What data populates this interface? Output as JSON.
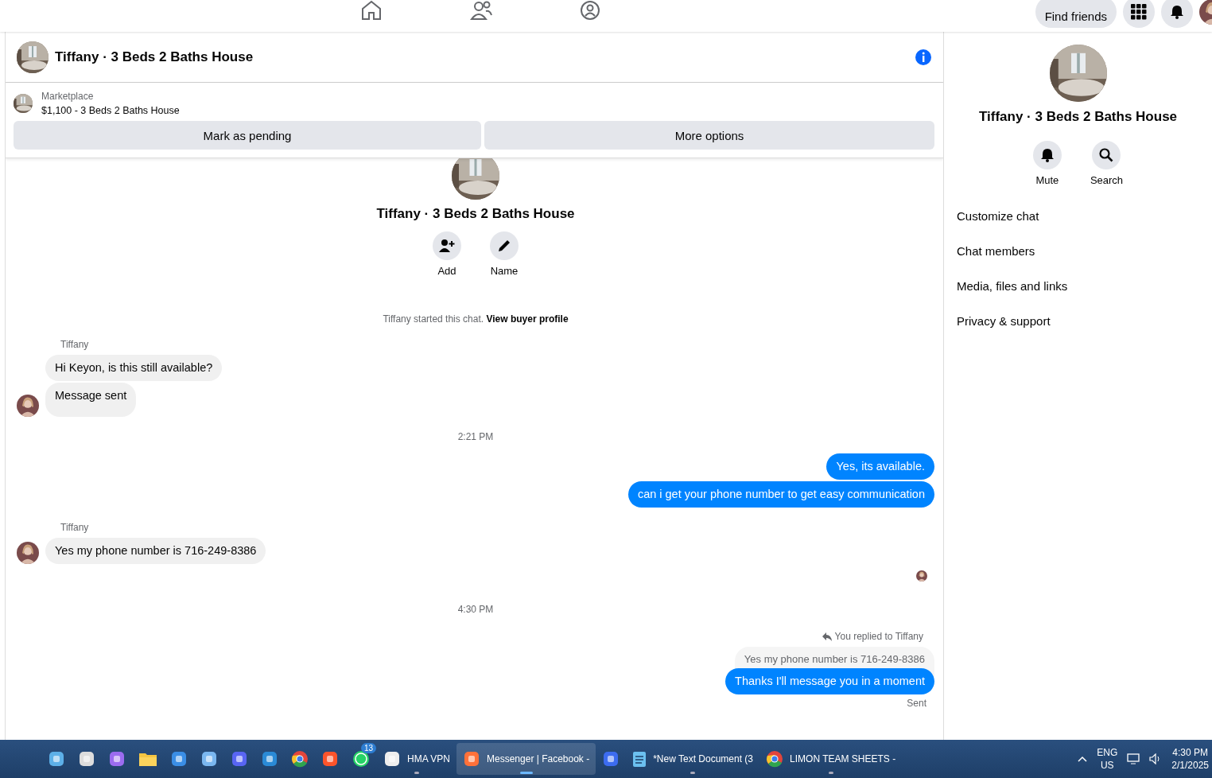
{
  "top_nav": {
    "find_friends": "Find friends"
  },
  "chat_header": {
    "title": "Tiffany · 3 Beds 2 Baths House"
  },
  "marketplace": {
    "label": "Marketplace",
    "listing": "$1,100 - 3 Beds 2 Baths House",
    "buttons": [
      "Mark as pending",
      "More options"
    ]
  },
  "chat_intro": {
    "title": "Tiffany · 3 Beds 2 Baths House",
    "actions": [
      {
        "kind": "add",
        "label": "Add"
      },
      {
        "kind": "name",
        "label": "Name"
      }
    ],
    "started_text": "Tiffany started this chat.",
    "link": "View buyer profile"
  },
  "messages": [
    {
      "kind": "sender",
      "text": "Tiffany"
    },
    {
      "kind": "incoming",
      "text": "Hi Keyon, is this still available?",
      "show_avatar": false
    },
    {
      "kind": "incoming",
      "text": "Message sent",
      "show_avatar": true
    },
    {
      "kind": "timestamp",
      "text": "2:21 PM"
    },
    {
      "kind": "outgoing",
      "text": "Yes, its available."
    },
    {
      "kind": "outgoing",
      "text": "can i get your phone number to get easy communication"
    },
    {
      "kind": "sender",
      "text": "Tiffany"
    },
    {
      "kind": "incoming",
      "text": "Yes my phone number is 716-249-8386",
      "show_avatar": true
    },
    {
      "kind": "read_receipt"
    },
    {
      "kind": "timestamp",
      "text": "4:30 PM"
    },
    {
      "kind": "reply_note",
      "text": "You replied to Tiffany"
    },
    {
      "kind": "quoted",
      "text": "Yes my phone number is 716-249-8386"
    },
    {
      "kind": "outgoing",
      "text": "Thanks I'll message you in a moment"
    },
    {
      "kind": "status",
      "text": "Sent"
    }
  ],
  "side_panel": {
    "title": "Tiffany · 3 Beds 2 Baths House",
    "actions": [
      {
        "kind": "mute",
        "label": "Mute"
      },
      {
        "kind": "search",
        "label": "Search"
      }
    ],
    "menu": [
      "Customize chat",
      "Chat members",
      "Media, files and links",
      "Privacy & support"
    ]
  },
  "taskbar": {
    "items": [
      {
        "kind": "widgets",
        "running": false,
        "active": false
      },
      {
        "kind": "taskview",
        "running": false,
        "active": false
      },
      {
        "kind": "copilot",
        "running": false,
        "active": false
      },
      {
        "kind": "explorer",
        "running": false,
        "active": false
      },
      {
        "kind": "store",
        "running": false,
        "active": false
      },
      {
        "kind": "chat",
        "running": false,
        "active": false
      },
      {
        "kind": "discord",
        "running": false,
        "active": false
      },
      {
        "kind": "vscode",
        "running": false,
        "active": false
      },
      {
        "kind": "chrome",
        "running": false,
        "active": false
      },
      {
        "kind": "brave",
        "running": false,
        "active": false
      },
      {
        "kind": "whatsapp",
        "badge": "13",
        "running": false,
        "active": false
      },
      {
        "kind": "vpn",
        "label": "HMA VPN",
        "running": true,
        "active": false
      },
      {
        "kind": "firefox",
        "label": "Messenger | Facebook -",
        "running": true,
        "active": true
      },
      {
        "kind": "app",
        "running": false,
        "active": false
      },
      {
        "kind": "notepad",
        "label": "*New Text Document (3",
        "running": true,
        "active": false
      },
      {
        "kind": "chrome",
        "label": "LIMON TEAM SHEETS -",
        "running": true,
        "active": false
      }
    ],
    "language": "ENG",
    "region": "US",
    "time": "4:30 PM",
    "date": "2/1/2025"
  }
}
